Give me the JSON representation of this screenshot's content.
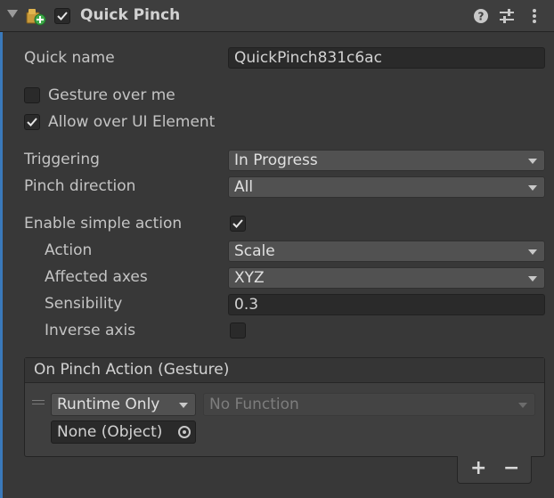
{
  "component": {
    "title": "Quick Pinch",
    "enabled": true,
    "icons": [
      "fold-arrow-icon",
      "component-script-icon",
      "help-icon",
      "presets-icon",
      "more-menu-icon"
    ]
  },
  "fields": {
    "quick_name": {
      "label": "Quick name",
      "value": "QuickPinch831c6ac"
    },
    "gesture_over_me": {
      "label": "Gesture over me",
      "checked": false
    },
    "allow_over_ui": {
      "label": "Allow over UI Element",
      "checked": true
    },
    "triggering": {
      "label": "Triggering",
      "value": "In Progress"
    },
    "pinch_direction": {
      "label": "Pinch direction",
      "value": "All"
    },
    "enable_simple_action": {
      "label": "Enable simple action",
      "checked": true
    },
    "action": {
      "label": "Action",
      "value": "Scale"
    },
    "affected_axes": {
      "label": "Affected axes",
      "value": "XYZ"
    },
    "sensibility": {
      "label": "Sensibility",
      "value": "0.3"
    },
    "inverse_axis": {
      "label": "Inverse axis",
      "checked": false
    }
  },
  "event": {
    "title": "On Pinch Action (Gesture)",
    "runtime": "Runtime Only",
    "function": "No Function",
    "object": "None (Object)",
    "add_label": "+",
    "remove_label": "−"
  },
  "colors": {
    "background": "#383838",
    "accent": "#3a79bb",
    "field_bg": "#2a2a2a",
    "dropdown_bg": "#515151"
  }
}
